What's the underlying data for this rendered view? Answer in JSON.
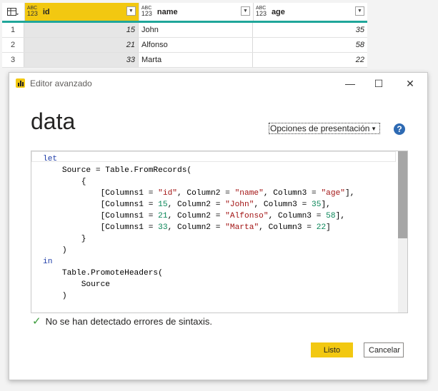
{
  "table": {
    "columns": [
      {
        "type_top": "ABC",
        "type_bottom": "123",
        "name": "id"
      },
      {
        "type_top": "ABC",
        "type_bottom": "123",
        "name": "name"
      },
      {
        "type_top": "ABC",
        "type_bottom": "123",
        "name": "age"
      }
    ],
    "rows": [
      {
        "n": "1",
        "id": "15",
        "name": "John",
        "age": "35"
      },
      {
        "n": "2",
        "id": "21",
        "name": "Alfonso",
        "age": "58"
      },
      {
        "n": "3",
        "id": "33",
        "name": "Marta",
        "age": "22"
      }
    ]
  },
  "dialog": {
    "title": "Editor avanzado",
    "query_name": "data",
    "options_label": "Opciones de presentación",
    "help_label": "?",
    "code_lines": [
      "let",
      "    Source = Table.FromRecords(",
      "        {",
      "            [Columns1 = \"id\", Column2 = \"name\", Column3 = \"age\"],",
      "            [Columns1 = 15, Column2 = \"John\", Column3 = 35],",
      "            [Columns1 = 21, Column2 = \"Alfonso\", Column3 = 58],",
      "            [Columns1 = 33, Column2 = \"Marta\", Column3 = 22]",
      "        }",
      "    )",
      "in",
      "    Table.PromoteHeaders(",
      "        Source",
      "    )"
    ],
    "status": "No se han detectado errores de sintaxis.",
    "ok_label": "Listo",
    "cancel_label": "Cancelar"
  },
  "colors": {
    "accent": "#f2c811",
    "header_underline": "#20a69a",
    "help": "#2e6ab3",
    "status_check": "#3a9a3a"
  }
}
